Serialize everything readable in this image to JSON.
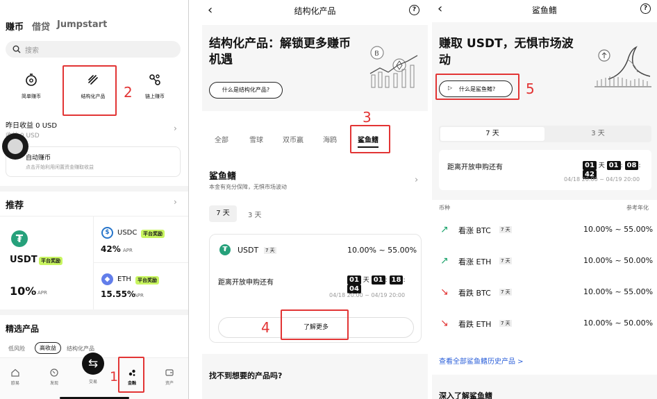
{
  "colors": {
    "accent_red": "#e23434",
    "tag_green": "#c8f560",
    "tether": "#26a17b",
    "usdc": "#2775ca",
    "eth": "#627eea",
    "up": "#1aa36b",
    "down": "#e23434"
  },
  "annotations": [
    "1",
    "2",
    "3",
    "4",
    "5"
  ],
  "screen1": {
    "top_tabs": [
      "赚币",
      "借贷",
      "Jumpstart"
    ],
    "search_placeholder": "搜索",
    "categories": [
      "简单赚币",
      "结构化产品",
      "链上赚币"
    ],
    "yesterday_earnings": "昨日收益 0 USD",
    "total_earnings": "收益 0 USD",
    "auto_earn_title": "自动赚币",
    "auto_earn_desc": "点击开始利用闲置资金赚取收益",
    "recommend_title": "推荐",
    "rec_usdt": {
      "symbol": "USDT",
      "tag": "平台奖励",
      "rate": "10%",
      "unit": "APR"
    },
    "rec_usdc": {
      "symbol": "USDC",
      "tag": "平台奖励",
      "rate": "42%",
      "unit": "APR"
    },
    "rec_eth": {
      "symbol": "ETH",
      "tag": "平台奖励",
      "rate": "15.55%",
      "unit": "APR"
    },
    "featured_title": "精选产品",
    "filters": [
      "低风险",
      "高收益",
      "结构化产品"
    ],
    "nav": [
      "欧易",
      "发现",
      "交易",
      "金融",
      "资产"
    ]
  },
  "screen2": {
    "title": "结构化产品",
    "hero_title": "结构化产品：解锁更多赚币机遇",
    "hero_button": "什么是结构化产品?",
    "tabs": [
      "全部",
      "雪球",
      "双币赢",
      "海鸥",
      "鲨鱼鳍"
    ],
    "section_title": "鲨鱼鳍",
    "section_desc": "本金有充分保障，无惧市场波动",
    "durations": [
      "7 天",
      "3 天"
    ],
    "product_symbol": "USDT",
    "product_days": "7 天",
    "product_rate": "10.00% ~ 55.00%",
    "countdown_label": "距离开放申购还有",
    "countdown": {
      "d": "01",
      "d_unit": "天",
      "h": "01",
      "m": "18",
      "s": "04"
    },
    "date_range": "04/18 20:00 ~ 04/19 20:00",
    "learn_more": "了解更多",
    "not_found": "找不到想要的产品吗?"
  },
  "screen3": {
    "title": "鲨鱼鳍",
    "hero_title": "赚取 USDT，无惧市场波动",
    "hero_button": "什么是鲨鱼鳍?",
    "durations": [
      "7 天",
      "3 天"
    ],
    "countdown_label": "距离开放申购还有",
    "countdown": {
      "d": "01",
      "d_unit": "天",
      "h": "01",
      "m": "08",
      "s": "42"
    },
    "date_range": "04/18 20:00 ~ 04/19 20:00",
    "col_coin": "币种",
    "col_rate": "参考年化",
    "products": [
      {
        "dir": "up",
        "name": "看涨 BTC",
        "days": "7 天",
        "rate": "10.00% ~ 55.00%"
      },
      {
        "dir": "up",
        "name": "看涨 ETH",
        "days": "7 天",
        "rate": "10.00% ~ 50.00%"
      },
      {
        "dir": "down",
        "name": "看跌 BTC",
        "days": "7 天",
        "rate": "10.00% ~ 55.00%"
      },
      {
        "dir": "down",
        "name": "看跌 ETH",
        "days": "7 天",
        "rate": "10.00% ~ 50.00%"
      }
    ],
    "history_link": "查看全部鲨鱼鳍历史产品 >",
    "deep_dive": "深入了解鲨鱼鳍"
  }
}
